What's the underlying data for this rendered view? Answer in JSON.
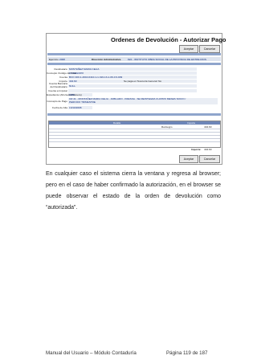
{
  "screenshot": {
    "title": "Ordenes de Devolución - Autorizar Pago",
    "buttons": {
      "accept": "Aceptar",
      "cancel": "Cancelar"
    },
    "exercise": {
      "label": "Ejercicio",
      "value": "2008"
    },
    "admin_direction": {
      "label": "Dirección Administrativa",
      "value": "822 - INSTITUTO OBRA SOCIAL DE LA PROVINCIA DE ENTRE RIOS"
    },
    "fields": [
      {
        "label": "Destinatario",
        "value": "MONTAÑEZ MARIA CELIA"
      },
      {
        "label": "Concepto /Código de Caso",
        "value": "COSEGURO"
      },
      {
        "label": "Cuenta",
        "value": "BCO 400-1-4610-0410-1-1-316-13-1-06-0 0-009"
      },
      {
        "label": "Importe",
        "value": "404.60",
        "extra": "Se paga en Tesorería General: No"
      },
      {
        "label": "Cuenta Bancaria del Destinatario",
        "value": "NULL"
      },
      {
        "label": "Cuenta a Imputar",
        "value": ""
      },
      {
        "label": "Expediente (Año/Letra/Número)",
        "value": "2008"
      },
      {
        "label": "Concepto de Pago",
        "value": "CR 21 - MONTAÑEZ MARIA CELIA - JUBILADO - PARANA - SE REINTEGRA CUATRO MESES SOCIO / PERIODO TRIMESTRE"
      },
      {
        "label": "Fecha de Alta",
        "value": "13/10/2008"
      }
    ],
    "grid": {
      "columns": [
        "Detalle",
        "Importe"
      ],
      "rows": [
        {
          "detail": "Reintegro",
          "amount": "404.60"
        }
      ]
    },
    "total": {
      "label": "Importe:",
      "value": "404.60"
    }
  },
  "paragraph": "En cualquier caso el sistema cierra la ventana y regresa al browser; pero en el caso de haber confirmado la autorización, en el browser se puede observar el estado de la orden de devolución como “autorizada”.",
  "footer": {
    "left": "Manual del Usuario – Módulo Contaduría",
    "right": "Página 119 de 187"
  }
}
